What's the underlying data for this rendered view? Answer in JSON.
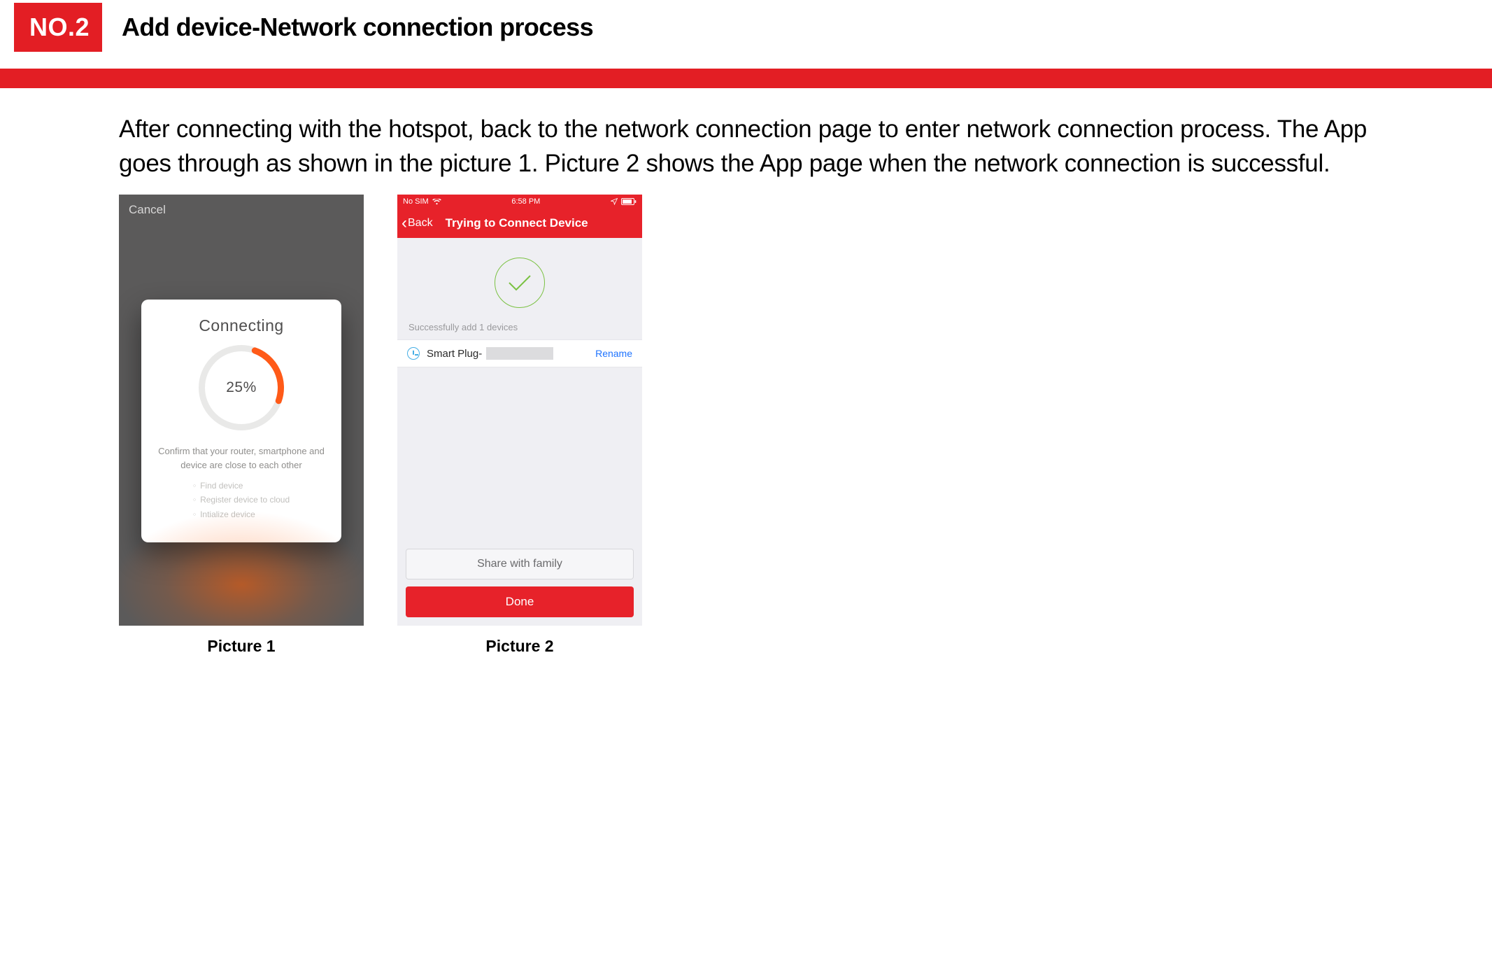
{
  "header": {
    "badge": "NO.2",
    "title": "Add device-Network connection process"
  },
  "body_text": "After connecting with the hotspot, back to the network connection page to enter network connection process. The App goes through as shown in the picture 1. Picture 2 shows the App page when the network connection is successful.",
  "picture1": {
    "cancel_label": "Cancel",
    "card_title": "Connecting",
    "progress_percent": 25,
    "progress_label": "25%",
    "instruction": "Confirm that your router, smartphone and device are close to each other",
    "steps": {
      "s1": "Find device",
      "s2": "Register device to cloud",
      "s3": "Intialize device"
    },
    "caption": "Picture 1"
  },
  "picture2": {
    "status": {
      "carrier": "No SIM",
      "time": "6:58 PM"
    },
    "back_label": "Back",
    "nav_title": "Trying to Connect Device",
    "success_text": "Successfully add 1 devices",
    "device_name": "Smart Plug-",
    "rename_label": "Rename",
    "share_label": "Share with family",
    "done_label": "Done",
    "caption": "Picture 2"
  }
}
